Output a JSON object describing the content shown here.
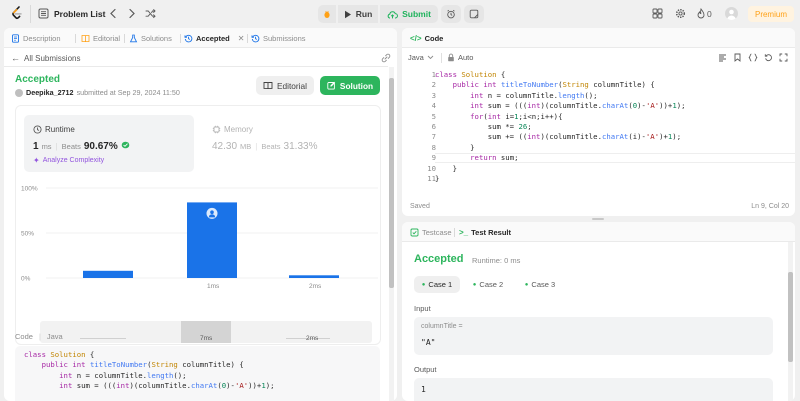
{
  "topbar": {
    "problem_list": "Problem List",
    "run": "Run",
    "submit": "Submit",
    "streak": "0",
    "premium": "Premium"
  },
  "left_tabs": {
    "description": "Description",
    "editorial": "Editorial",
    "solutions": "Solutions",
    "accepted": "Accepted",
    "submissions": "Submissions"
  },
  "submission": {
    "back": "All Submissions",
    "status": "Accepted",
    "user": "Deepika_2712",
    "submitted_text": "submitted at Sep 29, 2024 11:50",
    "editorial_btn": "Editorial",
    "solution_btn": "Solution"
  },
  "runtime": {
    "label": "Runtime",
    "value": "1",
    "unit": "ms",
    "beats_label": "Beats",
    "beats": "90.67%",
    "analyze": "Analyze Complexity"
  },
  "memory": {
    "label": "Memory",
    "value": "42.30",
    "unit": "MB",
    "beats_label": "Beats",
    "beats": "31.33%"
  },
  "chart_data": {
    "type": "bar",
    "y_ticks": [
      "100%",
      "50%",
      "0%"
    ],
    "ylim": [
      0,
      100
    ],
    "bars": [
      {
        "x": "0ms",
        "value": 8,
        "highlight": false
      },
      {
        "x": "1ms",
        "value": 84,
        "highlight": true
      },
      {
        "x": "2ms",
        "value": 3,
        "highlight": false
      }
    ],
    "x_labels": [
      "1ms",
      "2ms"
    ],
    "overview_labels": [
      "7ms",
      "2ms"
    ],
    "bar_color": "#1a73e8"
  },
  "code_section": {
    "label": "Code",
    "lang": "Java"
  },
  "preview_lines": [
    "class Solution {",
    "    public int titleToNumber(String columnTitle) {",
    "        int n = columnTitle.length();",
    "        int sum = (((int)(columnTitle.charAt(0)-'A'))+1);"
  ],
  "code_panel": {
    "title": "Code",
    "lang": "Java",
    "auto": "Auto",
    "saved": "Saved",
    "cursor": "Ln 9, Col 20"
  },
  "editor_lines": [
    "class Solution {",
    "    public int titleToNumber(String columnTitle) {",
    "        int n = columnTitle.length();",
    "        int sum = (((int)(columnTitle.charAt(0)-'A'))+1);",
    "        for(int i=1;i<n;i++){",
    "            sum *= 26;",
    "            sum += ((int)(columnTitle.charAt(i)-'A')+1);",
    "        }",
    "        return sum;",
    "    }",
    "}"
  ],
  "line_numbers": [
    "1",
    "2",
    "3",
    "4",
    "5",
    "6",
    "7",
    "8",
    "9",
    "10",
    "11"
  ],
  "test_tabs": {
    "testcase": "Testcase",
    "result": "Test Result"
  },
  "result": {
    "status": "Accepted",
    "runtime": "Runtime: 0 ms",
    "cases": [
      "Case 1",
      "Case 2",
      "Case 3"
    ],
    "input_label": "Input",
    "var_name": "columnTitle =",
    "var_value": "\"A\"",
    "output_label": "Output",
    "output_value": "1"
  }
}
